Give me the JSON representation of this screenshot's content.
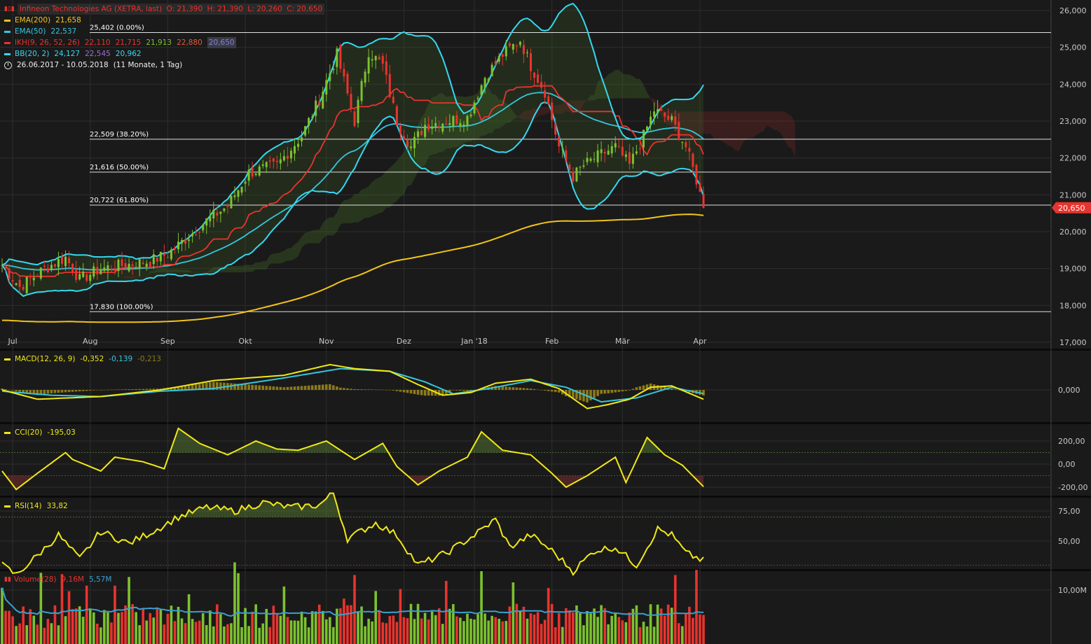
{
  "colors": {
    "bg": "#1a1a1a",
    "grid": "#2e2e2e",
    "axisText": "#c8c8c8",
    "up": "#7cc22e",
    "down": "#e8342e",
    "ema200": "#f2c418",
    "ema50": "#36c6dc",
    "ikhTenkan": "#e8342e",
    "ikhKijun": "#e8342e",
    "bb": "#35d8f0",
    "macd": "#f0e818",
    "signal": "#36c6dc",
    "hist": "#8c7a1a",
    "cci": "#f0e818",
    "rsi": "#f0e818",
    "volAvg": "#3aa0d0",
    "lastPrice": "#e8342e"
  },
  "legend": {
    "title": "Infineon Technologies AG (XETRA, last)",
    "o": "O: 21,390",
    "h": "H: 21,390",
    "l": "L: 20,260",
    "c": "C: 20,650",
    "ema200": {
      "label": "EMA(200)",
      "value": "21,658"
    },
    "ema50": {
      "label": "EMA(50)",
      "value": "22,537"
    },
    "ikh": {
      "label": "IKH(9, 26, 52, 26)",
      "v1": "22,110",
      "v2": "21,715",
      "v3": "21,913",
      "v4": "22,880",
      "v5": "20,650"
    },
    "bb": {
      "label": "BB(20, 2)",
      "v1": "24,127",
      "v2": "22,545",
      "v3": "20,962"
    },
    "range": {
      "dates": "26.06.2017 - 10.05.2018",
      "span": "(11 Monate, 1 Tag)"
    }
  },
  "macdLegend": {
    "label": "MACD(12, 26, 9)",
    "v1": "-0,352",
    "v2": "-0,139",
    "v3": "-0,213"
  },
  "cciLegend": {
    "label": "CCI(20)",
    "v1": "-195,03"
  },
  "rsiLegend": {
    "label": "RSI(14)",
    "v1": "33,82"
  },
  "volLegend": {
    "label": "Volume(28)",
    "v1": "9,16M",
    "v2": "5,57M"
  },
  "xAxis": {
    "labels": [
      {
        "t": "Jul",
        "i": 3
      },
      {
        "t": "Aug",
        "i": 25
      },
      {
        "t": "Sep",
        "i": 47
      },
      {
        "t": "Okt",
        "i": 69
      },
      {
        "t": "Nov",
        "i": 92
      },
      {
        "t": "Dez",
        "i": 114
      },
      {
        "t": "Jan '18",
        "i": 134
      },
      {
        "t": "Feb",
        "i": 156
      },
      {
        "t": "Mär",
        "i": 176
      },
      {
        "t": "Apr",
        "i": 198
      }
    ]
  },
  "priceAxis": {
    "min": 17,
    "max": 26,
    "ticks": [
      "17,000",
      "18,000",
      "19,000",
      "20,000",
      "21,000",
      "22,000",
      "23,000",
      "24,000",
      "25,000",
      "26,000"
    ],
    "last": "20,650",
    "lastValue": 20.65
  },
  "fib": [
    {
      "label": "25,402 (0.00%)",
      "v": 25.402
    },
    {
      "label": "22,509 (38.20%)",
      "v": 22.509
    },
    {
      "label": "21,616 (50.00%)",
      "v": 21.616
    },
    {
      "label": "20,722 (61.80%)",
      "v": 20.722
    },
    {
      "label": "17,830 (100.00%)",
      "v": 17.83
    }
  ],
  "macdAxis": {
    "ticks": [
      "0,000"
    ]
  },
  "cciAxis": {
    "ticks": [
      "200,00",
      "0,00",
      "-200,00"
    ]
  },
  "rsiAxis": {
    "ticks": [
      "75,00",
      "50,00"
    ]
  },
  "volAxis": {
    "ticks": [
      "10,00M"
    ]
  },
  "chart_data": {
    "type": "candlestick",
    "bars": 200,
    "price_ylim": [
      17,
      26
    ],
    "close_keypoints": [
      [
        0,
        19.1
      ],
      [
        5,
        18.5
      ],
      [
        12,
        19.0
      ],
      [
        18,
        19.3
      ],
      [
        22,
        18.7
      ],
      [
        28,
        19.0
      ],
      [
        35,
        19.1
      ],
      [
        42,
        19.2
      ],
      [
        47,
        19.4
      ],
      [
        52,
        19.8
      ],
      [
        58,
        20.3
      ],
      [
        64,
        20.7
      ],
      [
        70,
        21.6
      ],
      [
        78,
        21.8
      ],
      [
        85,
        22.6
      ],
      [
        90,
        23.6
      ],
      [
        95,
        24.8
      ],
      [
        100,
        23.0
      ],
      [
        104,
        24.9
      ],
      [
        108,
        24.5
      ],
      [
        112,
        23.0
      ],
      [
        116,
        22.3
      ],
      [
        120,
        22.9
      ],
      [
        126,
        23.0
      ],
      [
        132,
        23.1
      ],
      [
        137,
        24.2
      ],
      [
        142,
        24.8
      ],
      [
        147,
        25.2
      ],
      [
        150,
        24.5
      ],
      [
        154,
        23.8
      ],
      [
        158,
        22.3
      ],
      [
        162,
        21.5
      ],
      [
        165,
        21.8
      ],
      [
        170,
        22.1
      ],
      [
        174,
        22.3
      ],
      [
        178,
        21.8
      ],
      [
        182,
        22.6
      ],
      [
        185,
        23.3
      ],
      [
        190,
        23.0
      ],
      [
        194,
        22.3
      ],
      [
        197,
        21.4
      ],
      [
        199,
        20.65
      ]
    ],
    "macd_keypoints": [
      [
        0,
        0.0
      ],
      [
        10,
        -0.35
      ],
      [
        28,
        -0.25
      ],
      [
        45,
        0.0
      ],
      [
        60,
        0.35
      ],
      [
        80,
        0.55
      ],
      [
        93,
        0.95
      ],
      [
        100,
        0.8
      ],
      [
        110,
        0.7
      ],
      [
        118,
        0.2
      ],
      [
        125,
        -0.2
      ],
      [
        133,
        -0.1
      ],
      [
        140,
        0.25
      ],
      [
        150,
        0.4
      ],
      [
        158,
        0.05
      ],
      [
        166,
        -0.7
      ],
      [
        172,
        -0.55
      ],
      [
        178,
        -0.35
      ],
      [
        184,
        0.1
      ],
      [
        190,
        0.15
      ],
      [
        199,
        -0.35
      ]
    ],
    "signal_keypoints": [
      [
        0,
        -0.05
      ],
      [
        14,
        -0.2
      ],
      [
        28,
        -0.25
      ],
      [
        45,
        -0.05
      ],
      [
        60,
        0.05
      ],
      [
        80,
        0.45
      ],
      [
        96,
        0.8
      ],
      [
        110,
        0.7
      ],
      [
        120,
        0.3
      ],
      [
        128,
        -0.15
      ],
      [
        138,
        0.05
      ],
      [
        150,
        0.35
      ],
      [
        160,
        0.1
      ],
      [
        170,
        -0.45
      ],
      [
        180,
        -0.3
      ],
      [
        190,
        0.1
      ],
      [
        199,
        -0.14
      ]
    ],
    "cci_keypoints": [
      [
        0,
        -60
      ],
      [
        4,
        -220
      ],
      [
        10,
        -80
      ],
      [
        18,
        100
      ],
      [
        20,
        40
      ],
      [
        28,
        -60
      ],
      [
        32,
        60
      ],
      [
        40,
        20
      ],
      [
        46,
        -40
      ],
      [
        50,
        310
      ],
      [
        56,
        180
      ],
      [
        64,
        80
      ],
      [
        72,
        200
      ],
      [
        78,
        130
      ],
      [
        84,
        120
      ],
      [
        92,
        200
      ],
      [
        100,
        40
      ],
      [
        108,
        180
      ],
      [
        112,
        -20
      ],
      [
        118,
        -180
      ],
      [
        124,
        -60
      ],
      [
        132,
        60
      ],
      [
        136,
        280
      ],
      [
        142,
        120
      ],
      [
        150,
        80
      ],
      [
        156,
        -80
      ],
      [
        160,
        -200
      ],
      [
        166,
        -100
      ],
      [
        174,
        60
      ],
      [
        177,
        -160
      ],
      [
        183,
        230
      ],
      [
        188,
        80
      ],
      [
        193,
        -10
      ],
      [
        199,
        -195
      ]
    ],
    "rsi_keypoints": [
      [
        0,
        30
      ],
      [
        4,
        22
      ],
      [
        10,
        38
      ],
      [
        16,
        55
      ],
      [
        22,
        35
      ],
      [
        28,
        58
      ],
      [
        36,
        48
      ],
      [
        44,
        60
      ],
      [
        50,
        70
      ],
      [
        58,
        78
      ],
      [
        66,
        75
      ],
      [
        74,
        82
      ],
      [
        82,
        78
      ],
      [
        90,
        80
      ],
      [
        94,
        90
      ],
      [
        98,
        52
      ],
      [
        106,
        65
      ],
      [
        112,
        55
      ],
      [
        118,
        30
      ],
      [
        126,
        40
      ],
      [
        134,
        55
      ],
      [
        140,
        68
      ],
      [
        144,
        45
      ],
      [
        150,
        55
      ],
      [
        156,
        42
      ],
      [
        162,
        25
      ],
      [
        168,
        42
      ],
      [
        174,
        45
      ],
      [
        180,
        30
      ],
      [
        186,
        60
      ],
      [
        190,
        55
      ],
      [
        194,
        40
      ],
      [
        199,
        33.8
      ]
    ],
    "title": "Infineon Technologies AG (XETRA, last)"
  }
}
